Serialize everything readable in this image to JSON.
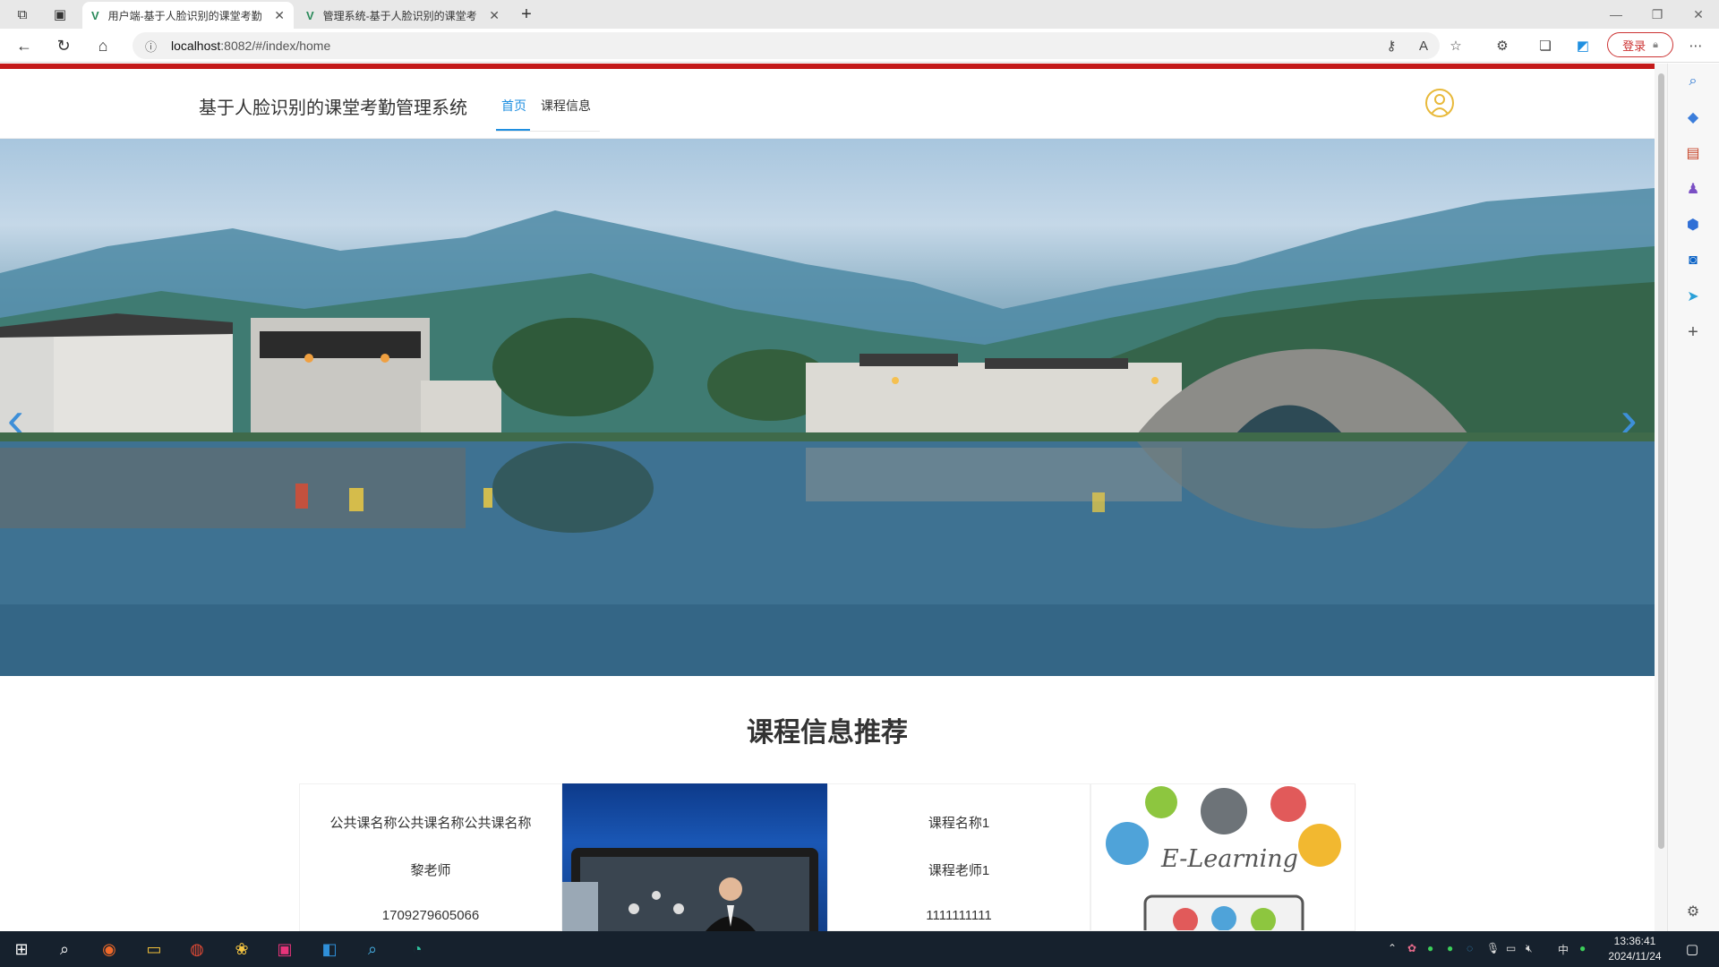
{
  "browser": {
    "tabs": [
      {
        "title": "用户端-基于人脸识别的课堂考勤",
        "active": true
      },
      {
        "title": "管理系统-基于人脸识别的课堂考",
        "active": false
      }
    ],
    "url_host": "localhost",
    "url_path": ":8082/#/index/home",
    "login_label": "登录"
  },
  "site": {
    "title": "基于人脸识别的课堂考勤管理系统",
    "nav": [
      {
        "label": "首页",
        "active": true
      },
      {
        "label": "课程信息",
        "active": false
      }
    ],
    "accent_color": "#1f8fe0",
    "brand_bar_color": "#c41a1a"
  },
  "section": {
    "title": "课程信息推荐",
    "cards": [
      {
        "name": "公共课名称公共课名称公共课名称",
        "teacher": "黎老师",
        "phone": "1709279605066"
      },
      {
        "name": "课程名称1",
        "teacher": "课程老师1",
        "phone": "1111111111"
      }
    ],
    "elearning_text": "E-Learning"
  },
  "taskbar": {
    "ime": "中",
    "time": "13:36:41",
    "date": "2024/11/24"
  }
}
